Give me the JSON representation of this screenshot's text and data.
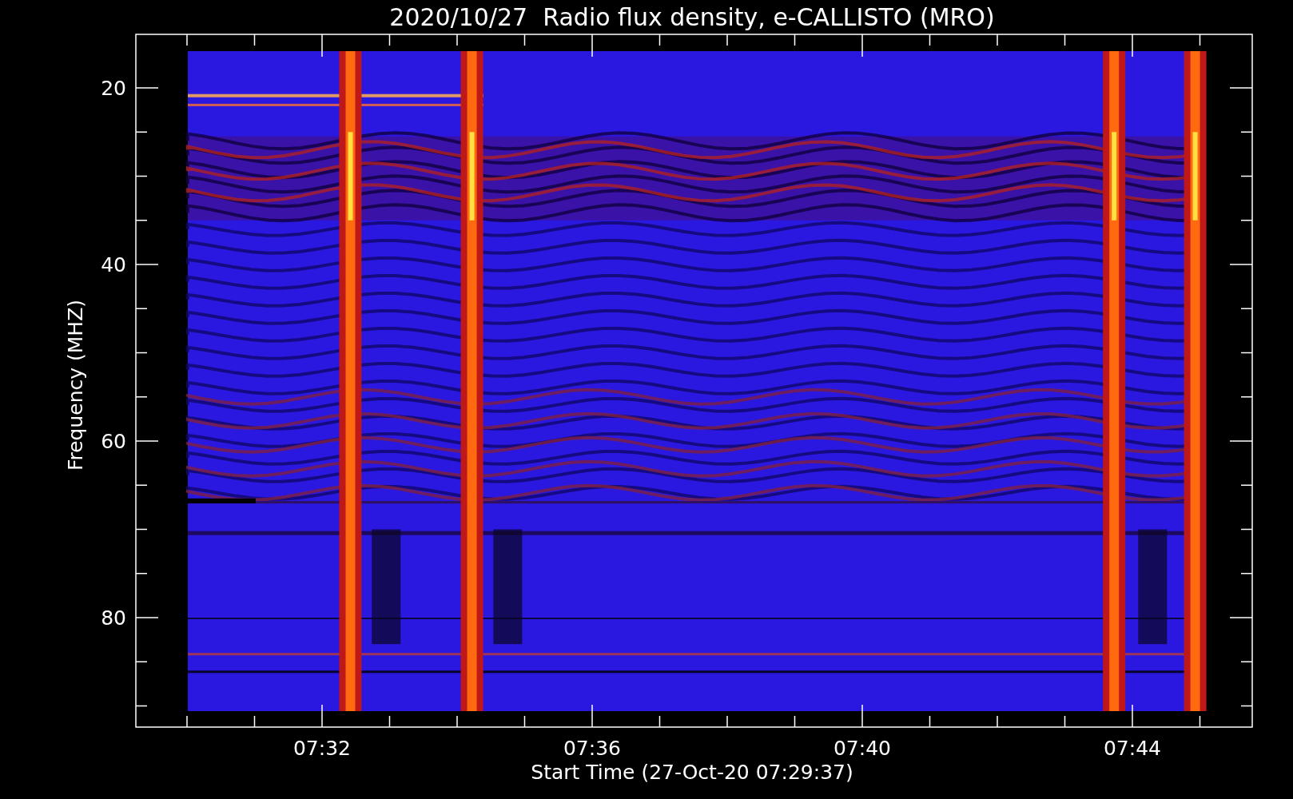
{
  "title": "2020/10/27  Radio flux density, e-CALLISTO (MRO)",
  "y_axis": {
    "label": "Frequency (MHZ)",
    "ticks": [
      "20",
      "40",
      "60",
      "80"
    ]
  },
  "x_axis": {
    "label": "Start Time (27-Oct-20 07:29:37)",
    "ticks": [
      "07:32",
      "07:36",
      "07:40",
      "07:44"
    ]
  }
}
